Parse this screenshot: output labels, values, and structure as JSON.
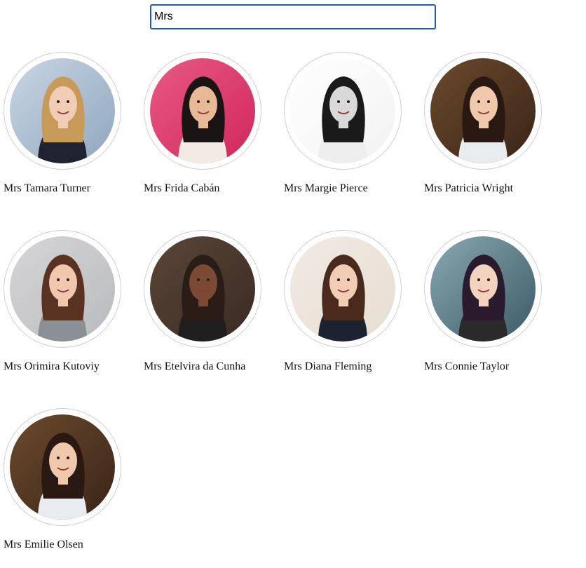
{
  "search": {
    "value": "Mrs",
    "placeholder": ""
  },
  "people": [
    {
      "name": "Mrs Tamara Turner",
      "photo": "woman-waterfront-photo",
      "palette": {
        "bg": "#8fa6bf",
        "bg2": "#c9d6e3",
        "hair": "#c89a5a",
        "skin": "#f0cdb4",
        "shirt": "#1f2230"
      }
    },
    {
      "name": "Mrs Frida Cabán",
      "photo": "woman-curly-hair-red-wall-photo",
      "palette": {
        "bg": "#d1265a",
        "bg2": "#e85a83",
        "hair": "#1b1414",
        "skin": "#e7b996",
        "shirt": "#f1ebe4"
      }
    },
    {
      "name": "Mrs Margie Pierce",
      "photo": "woman-monochrome-profile-photo",
      "palette": {
        "bg": "#f2f2f2",
        "bg2": "#ffffff",
        "hair": "#1a1a1a",
        "skin": "#d9d9d9",
        "shirt": "#eeeeee"
      }
    },
    {
      "name": "Mrs Patricia Wright",
      "photo": "woman-restaurant-photo",
      "palette": {
        "bg": "#3a2418",
        "bg2": "#6b4a2c",
        "hair": "#2a1812",
        "skin": "#f0c9ad",
        "shirt": "#e8ecef"
      }
    },
    {
      "name": "Mrs Orimira Kutoviy",
      "photo": "woman-surprised-gray-wall-photo",
      "palette": {
        "bg": "#b9babd",
        "bg2": "#d6d6d8",
        "hair": "#5a3222",
        "skin": "#f1c7ad",
        "shirt": "#8c8f94"
      }
    },
    {
      "name": "Mrs Etelvira da Cunha",
      "photo": "woman-braids-photo",
      "palette": {
        "bg": "#3a2a22",
        "bg2": "#5b4638",
        "hair": "#2a1d17",
        "skin": "#7a4a34",
        "shirt": "#1f1f1f"
      }
    },
    {
      "name": "Mrs Diana Fleming",
      "photo": "woman-dark-vest-photo",
      "palette": {
        "bg": "#e7ddd2",
        "bg2": "#f1ebe4",
        "hair": "#4a2a1d",
        "skin": "#f2cdb6",
        "shirt": "#1c2230"
      }
    },
    {
      "name": "Mrs Connie Taylor",
      "photo": "woman-car-selfie-photo",
      "palette": {
        "bg": "#3a5a66",
        "bg2": "#8aa8b0",
        "hair": "#2a1a2e",
        "skin": "#f3d2bf",
        "shirt": "#2a2a2a"
      }
    },
    {
      "name": "Mrs Emilie Olsen",
      "photo": "woman-restaurant-photo",
      "palette": {
        "bg": "#3a2418",
        "bg2": "#6b4a2c",
        "hair": "#2a1812",
        "skin": "#f0c9ad",
        "shirt": "#e8ecef"
      }
    }
  ]
}
